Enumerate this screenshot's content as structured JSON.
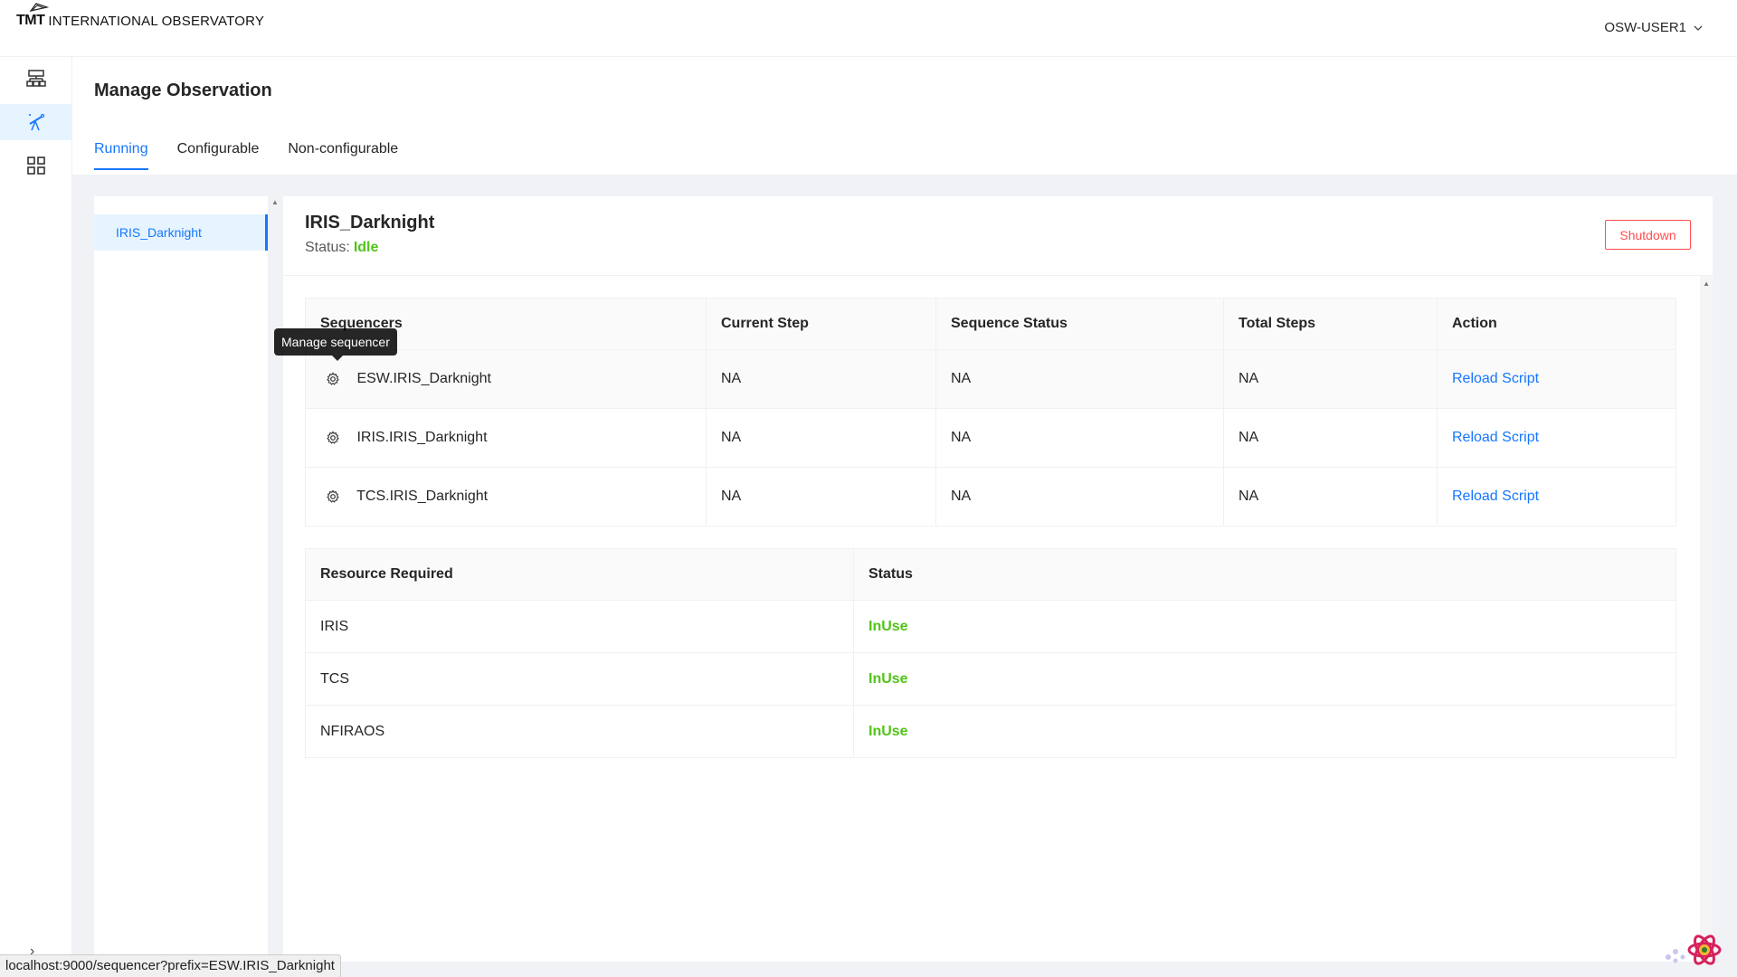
{
  "header": {
    "logo_mark": "TMT",
    "logo_text": "INTERNATIONAL OBSERVATORY",
    "user": "OSW-USER1"
  },
  "rail": {
    "items": [
      {
        "icon": "hierarchy-icon"
      },
      {
        "icon": "telescope-icon",
        "active": true
      },
      {
        "icon": "grid-icon"
      }
    ]
  },
  "page": {
    "title": "Manage Observation",
    "tabs": [
      {
        "label": "Running",
        "active": true
      },
      {
        "label": "Configurable"
      },
      {
        "label": "Non-configurable"
      }
    ]
  },
  "observations": [
    "IRIS_Darknight"
  ],
  "detail": {
    "title": "IRIS_Darknight",
    "status_label": "Status:",
    "status_value": "Idle",
    "shutdown_label": "Shutdown"
  },
  "sequencers_table": {
    "headers": [
      "Sequencers",
      "Current Step",
      "Sequence Status",
      "Total Steps",
      "Action"
    ],
    "rows": [
      {
        "name": "ESW.IRIS_Darknight",
        "current_step": "NA",
        "status": "NA",
        "total": "NA",
        "action": "Reload Script"
      },
      {
        "name": "IRIS.IRIS_Darknight",
        "current_step": "NA",
        "status": "NA",
        "total": "NA",
        "action": "Reload Script"
      },
      {
        "name": "TCS.IRIS_Darknight",
        "current_step": "NA",
        "status": "NA",
        "total": "NA",
        "action": "Reload Script"
      }
    ]
  },
  "resources_table": {
    "headers": [
      "Resource Required",
      "Status"
    ],
    "rows": [
      {
        "resource": "IRIS",
        "status": "InUse"
      },
      {
        "resource": "TCS",
        "status": "InUse"
      },
      {
        "resource": "NFIRAOS",
        "status": "InUse"
      }
    ]
  },
  "tooltip": "Manage sequencer",
  "status_url": "localhost:9000/sequencer?prefix=ESW.IRIS_Darknight",
  "colors": {
    "accent": "#1677ff",
    "success": "#52c41a",
    "danger": "#ff4d4f"
  }
}
